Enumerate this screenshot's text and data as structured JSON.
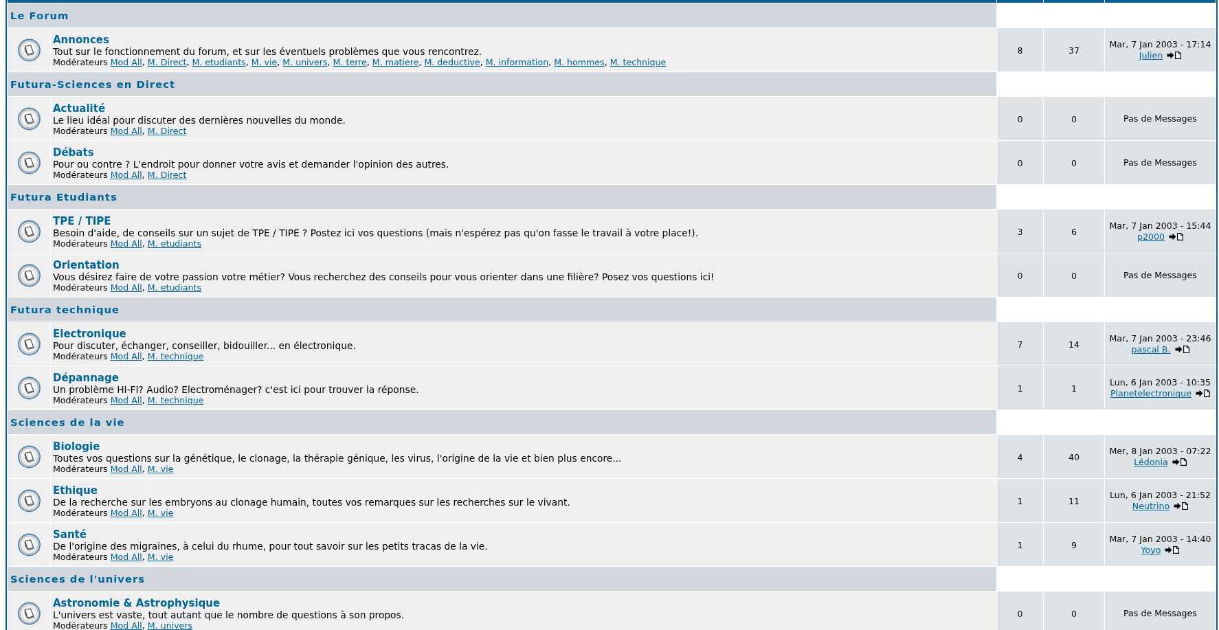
{
  "categories": [
    {
      "title": "Le Forum",
      "forums": [
        {
          "name": "Annonces",
          "description": "Tout sur le fonctionnement du forum, et sur les éventuels problèmes que vous rencontrez.",
          "moderators": {
            "label": "Modérateurs",
            "separator": ",",
            "names": [
              "Mod All",
              "M. Direct",
              "M. etudiants",
              "M. vie",
              "M. univers",
              "M. terre",
              "M. matiere",
              "M. deductive",
              "M. information",
              "M. hommes",
              "M. technique"
            ]
          },
          "topics": "8",
          "posts": "37",
          "last_post": {
            "kind": "post",
            "date": "Mar, 7 Jan 2003 - 17:14",
            "author": "Julien"
          }
        }
      ]
    },
    {
      "title": "Futura-Sciences en Direct",
      "forums": [
        {
          "name": "Actualité",
          "description": "Le lieu idéal pour discuter des dernières nouvelles du monde.",
          "moderators": {
            "label": "Modérateurs",
            "separator": ",",
            "names": [
              "Mod All",
              "M. Direct"
            ]
          },
          "topics": "0",
          "posts": "0",
          "last_post": {
            "kind": "none",
            "text": "Pas de Messages"
          }
        },
        {
          "name": "Débats",
          "description": "Pour ou contre ? L'endroit pour donner votre avis et demander l'opinion des autres.",
          "moderators": {
            "label": "Modérateurs",
            "separator": ",",
            "names": [
              "Mod All",
              "M. Direct"
            ]
          },
          "topics": "0",
          "posts": "0",
          "last_post": {
            "kind": "none",
            "text": "Pas de Messages"
          }
        }
      ]
    },
    {
      "title": "Futura Etudiants",
      "forums": [
        {
          "name": "TPE / TIPE",
          "description": "Besoin d'aide, de conseils sur un sujet de TPE / TIPE ? Postez ici vos questions (mais n'espérez pas qu'on fasse le travail à votre place!).",
          "moderators": {
            "label": "Modérateurs",
            "separator": ",",
            "names": [
              "Mod All",
              "M. etudiants"
            ]
          },
          "topics": "3",
          "posts": "6",
          "last_post": {
            "kind": "post",
            "date": "Mar, 7 Jan 2003 - 15:44",
            "author": "p2000"
          }
        },
        {
          "name": "Orientation",
          "description": "Vous désirez faire de votre passion votre métier? Vous recherchez des conseils pour vous orienter dans une filière? Posez vos questions ici!",
          "moderators": {
            "label": "Modérateurs",
            "separator": ",",
            "names": [
              "Mod All",
              "M. etudiants"
            ]
          },
          "topics": "0",
          "posts": "0",
          "last_post": {
            "kind": "none",
            "text": "Pas de Messages"
          }
        }
      ]
    },
    {
      "title": "Futura technique",
      "forums": [
        {
          "name": "Electronique",
          "description": "Pour discuter, échanger, conseiller, bidouiller... en électronique.",
          "moderators": {
            "label": "Modérateurs",
            "separator": ",",
            "names": [
              "Mod All",
              "M. technique"
            ]
          },
          "topics": "7",
          "posts": "14",
          "last_post": {
            "kind": "post",
            "date": "Mar, 7 Jan 2003 - 23:46",
            "author": "pascal B."
          }
        },
        {
          "name": "Dépannage",
          "description": "Un problème HI-FI? Audio? Electroménager? c'est ici pour trouver la réponse.",
          "moderators": {
            "label": "Modérateurs",
            "separator": ",",
            "names": [
              "Mod All",
              "M. technique"
            ]
          },
          "topics": "1",
          "posts": "1",
          "last_post": {
            "kind": "post",
            "date": "Lun, 6 Jan 2003 - 10:35",
            "author": "Planetelectronique"
          }
        }
      ]
    },
    {
      "title": "Sciences de la vie",
      "forums": [
        {
          "name": "Biologie",
          "description": "Toutes vos questions sur la génétique, le clonage, la thérapie génique, les virus, l'origine de la vie et bien plus encore...",
          "moderators": {
            "label": "Modérateurs",
            "separator": ",",
            "names": [
              "Mod All",
              "M. vie"
            ]
          },
          "topics": "4",
          "posts": "40",
          "last_post": {
            "kind": "post",
            "date": "Mer, 8 Jan 2003 - 07:22",
            "author": "Lédonia"
          }
        },
        {
          "name": "Ethique",
          "description": "De la recherche sur les embryons au clonage humain, toutes vos remarques sur les recherches sur le vivant.",
          "moderators": {
            "label": "Modérateurs",
            "separator": ",",
            "names": [
              "Mod All",
              "M. vie"
            ]
          },
          "topics": "1",
          "posts": "11",
          "last_post": {
            "kind": "post",
            "date": "Lun, 6 Jan 2003 - 21:52",
            "author": "Neutrino"
          }
        },
        {
          "name": "Santé",
          "description": "De l'origine des migraines, à celui du rhume, pour tout savoir sur les petits tracas de la vie.",
          "moderators": {
            "label": "Modérateurs",
            "separator": ",",
            "names": [
              "Mod All",
              "M. vie"
            ]
          },
          "topics": "1",
          "posts": "9",
          "last_post": {
            "kind": "post",
            "date": "Mar, 7 Jan 2003 - 14:40",
            "author": "Yoyo"
          }
        }
      ]
    },
    {
      "title": "Sciences de l'univers",
      "forums": [
        {
          "name": "Astronomie & Astrophysique",
          "description": "L'univers est vaste, tout autant que le nombre de questions à son propos.",
          "moderators": {
            "label": "Modérateurs",
            "separator": ",",
            "names": [
              "Mod All",
              "M. univers"
            ]
          },
          "topics": "0",
          "posts": "0",
          "last_post": {
            "kind": "none",
            "text": "Pas de Messages"
          }
        }
      ]
    }
  ]
}
